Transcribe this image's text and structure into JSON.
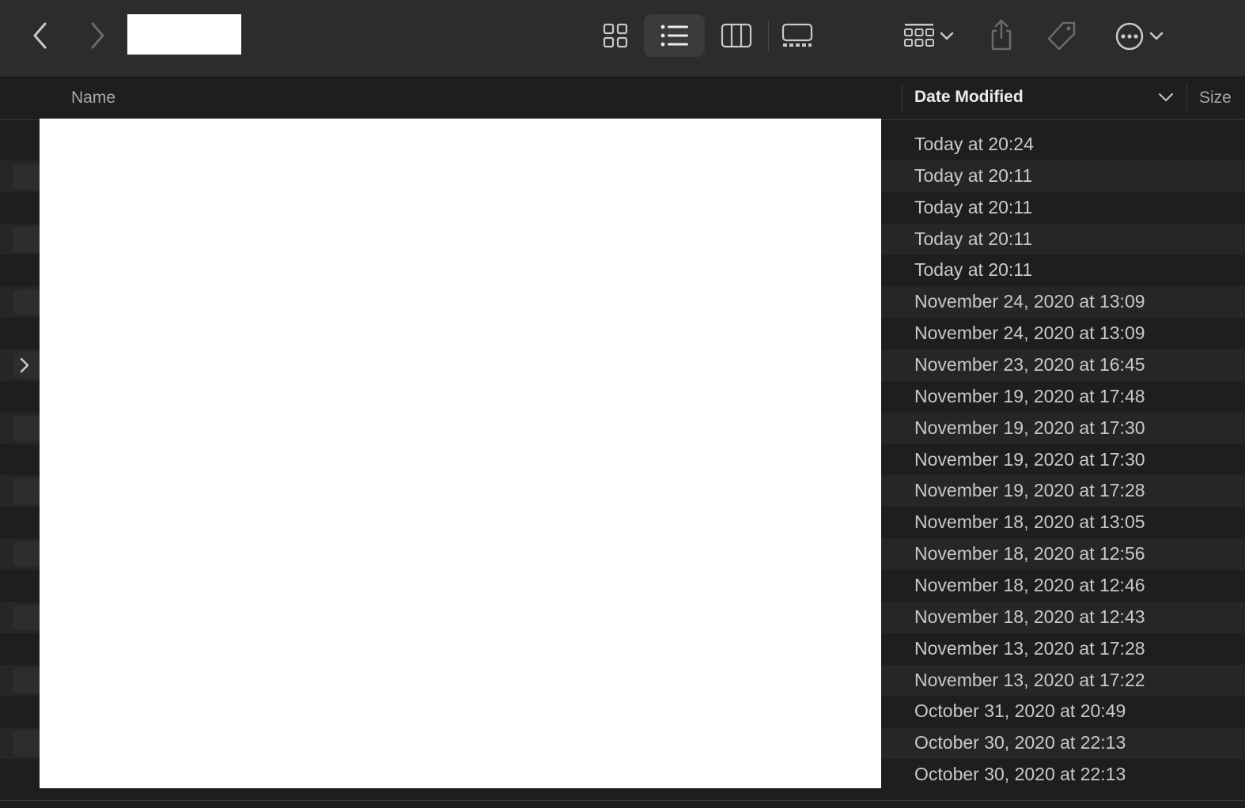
{
  "toolbar": {
    "back_icon": "chevron-left-icon",
    "forward_icon": "chevron-right-icon",
    "views": [
      "icon-view",
      "list-view",
      "column-view",
      "gallery-view"
    ],
    "selected_view": "list-view",
    "group_icon": "group-icon",
    "share_icon": "share-icon",
    "tag_icon": "tag-icon",
    "more_icon": "ellipsis-circle-icon"
  },
  "columns": {
    "name": "Name",
    "date_modified": "Date Modified",
    "size": "Size"
  },
  "rows": [
    {
      "date": "Today at 20:24"
    },
    {
      "date": "Today at 20:11"
    },
    {
      "date": "Today at 20:11"
    },
    {
      "date": "Today at 20:11"
    },
    {
      "date": "Today at 20:11"
    },
    {
      "date": "November 24, 2020 at 13:09"
    },
    {
      "date": "November 24, 2020 at 13:09"
    },
    {
      "date": "November 23, 2020 at 16:45"
    },
    {
      "date": "November 19, 2020 at 17:48"
    },
    {
      "date": "November 19, 2020 at 17:30"
    },
    {
      "date": "November 19, 2020 at 17:30"
    },
    {
      "date": "November 19, 2020 at 17:28"
    },
    {
      "date": "November 18, 2020 at 13:05"
    },
    {
      "date": "November 18, 2020 at 12:56"
    },
    {
      "date": "November 18, 2020 at 12:46"
    },
    {
      "date": "November 18, 2020 at 12:43"
    },
    {
      "date": "November 13, 2020 at 17:28"
    },
    {
      "date": "November 13, 2020 at 17:22"
    },
    {
      "date": "October 31, 2020 at 20:49"
    },
    {
      "date": "October 30, 2020 at 22:13"
    },
    {
      "date": "October 30, 2020 at 22:13"
    }
  ]
}
